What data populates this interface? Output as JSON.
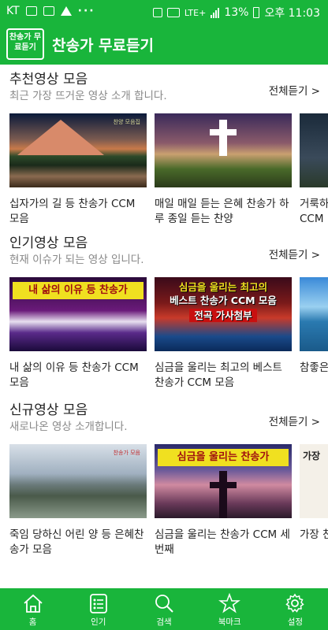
{
  "status_bar": {
    "carrier": "KT",
    "dots": "···",
    "network": "LTE+",
    "battery": "13%",
    "time": "오후 11:03"
  },
  "app": {
    "logo_text": "찬송가 무료듣기",
    "title": "찬송가 무료듣기"
  },
  "sections": [
    {
      "title": "추천영상 모음",
      "subtitle": "최근 가장 뜨거운 영상 소개 합니다.",
      "more": "전체듣기 >",
      "items": [
        {
          "caption": "십자가의 길 등 찬송가 CCM 모음",
          "thumb_label": "찬양 모음집"
        },
        {
          "caption": "매일 매일 듣는 은혜 찬송가 하루 종일 듣는 찬양"
        },
        {
          "caption": "거룩하신 하나님 등 찬송가 CCM"
        }
      ]
    },
    {
      "title": "인기영상 모음",
      "subtitle": "현재 이슈가 되는 영상 입니다.",
      "more": "전체듣기 >",
      "items": [
        {
          "caption": "내 삶의 이유 등 찬송가 CCM 모음",
          "thumb_label": "내 삶의 이유 등 찬송가"
        },
        {
          "caption": "심금을 울리는 최고의 베스트 찬송가 CCM 모음",
          "thumb_line1": "심금을 울리는 최고의",
          "thumb_line2": "베스트 찬송가 CCM 모음",
          "thumb_line3": "전곡 가사첨부"
        },
        {
          "caption": "참좋은 찬송가 따라부르기"
        }
      ]
    },
    {
      "title": "신규영상 모음",
      "subtitle": "새로나온 영상 소개합니다.",
      "more": "전체듣기 >",
      "items": [
        {
          "caption": "죽임 당하신 어린 양 등 은혜찬송가 모음",
          "thumb_label": "찬송가 모음"
        },
        {
          "caption": "심금을 울리는 찬송가 CCM 세번째",
          "thumb_label": "심금을 울리는 찬송가"
        },
        {
          "caption": "가장 찬송가 CCM",
          "thumb_label": "가장"
        }
      ]
    }
  ],
  "bottom_nav": [
    {
      "label": "홈",
      "icon": "home-icon"
    },
    {
      "label": "인기",
      "icon": "list-icon"
    },
    {
      "label": "검색",
      "icon": "search-icon"
    },
    {
      "label": "북마크",
      "icon": "star-icon"
    },
    {
      "label": "설정",
      "icon": "gear-icon"
    }
  ],
  "colors": {
    "brand_green": "#19b53b",
    "banner_yellow": "#f0e020"
  }
}
